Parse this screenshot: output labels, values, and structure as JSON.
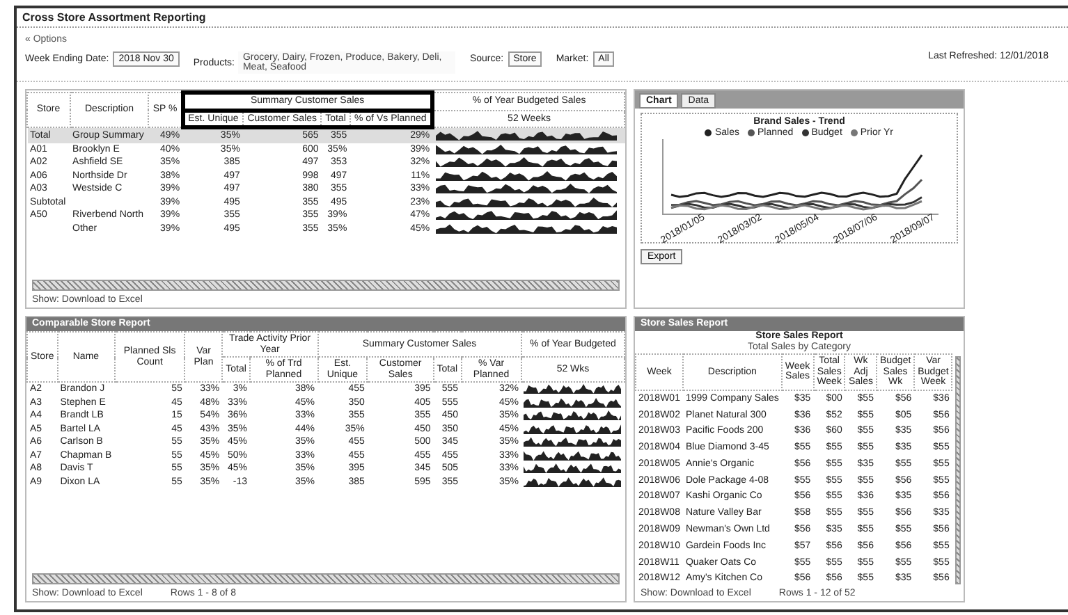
{
  "window": {
    "title": "Cross Store Assortment Reporting"
  },
  "options_link": "« Options",
  "filters": [
    {
      "label": "Week Ending Date:",
      "value": "2018 Nov 30"
    },
    {
      "label": "Products:",
      "value": "Grocery, Dairy, Frozen, Produce, Bakery, Deli, Meat, Seafood"
    },
    {
      "label": "Source:",
      "value": "Store"
    },
    {
      "label": "Market:",
      "value": "All"
    }
  ],
  "last_refreshed": "Last Refreshed: 12/01/2018",
  "summary_table": {
    "columns": [
      {
        "label": "Store"
      },
      {
        "label": "Description"
      },
      {
        "label": "SP %"
      },
      {
        "label": "Summary Customer Sales",
        "highlighted": true,
        "colspan": 4,
        "children": [
          "Est. Unique",
          "Customer Sales",
          "Total",
          "% of Vs Planned"
        ]
      },
      {
        "label": "% of Year Budgeted Sales",
        "children": [
          "52 Weeks"
        ]
      }
    ],
    "rows": [
      {
        "selected": true,
        "cells": [
          "Total",
          "Group Summary",
          "49%",
          "35%",
          "565",
          "355",
          "29%"
        ]
      },
      {
        "selected": false,
        "cells": [
          "A01",
          "Brooklyn E",
          "40%",
          "35%",
          "600",
          "35%",
          "39%"
        ]
      },
      {
        "selected": false,
        "cells": [
          "A02",
          "Ashfield SE",
          "35%",
          "385",
          "497",
          "353",
          "32%"
        ]
      },
      {
        "selected": false,
        "cells": [
          "A06",
          "Northside Dr",
          "38%",
          "497",
          "998",
          "497",
          "11%"
        ]
      },
      {
        "selected": false,
        "cells": [
          "A03",
          "Westside C",
          "39%",
          "497",
          "380",
          "355",
          "33%"
        ]
      },
      {
        "selected": false,
        "cells": [
          "Subtotal",
          "",
          "39%",
          "495",
          "355",
          "495",
          "23%"
        ]
      },
      {
        "selected": false,
        "cells": [
          "A50",
          "Riverbend North",
          "39%",
          "355",
          "355",
          "39%",
          "47%"
        ]
      },
      {
        "selected": false,
        "cells": [
          "",
          "Other",
          "39%",
          "495",
          "355",
          "35%",
          "45%"
        ]
      }
    ],
    "footer": "Show: Download to Excel"
  },
  "chart_panel": {
    "tabs": [
      {
        "label": "Chart",
        "selected": true
      },
      {
        "label": "Data",
        "selected": false
      }
    ],
    "title": "Brand Sales - Trend",
    "legend": [
      {
        "label": "Sales",
        "color": "#222222"
      },
      {
        "label": "Planned",
        "color": "#555555"
      },
      {
        "label": "Budget",
        "color": "#333333"
      },
      {
        "label": "Prior Yr",
        "color": "#777777"
      }
    ],
    "x_labels": [
      "2018/01/05",
      "2018/03/02",
      "2018/05/04",
      "2018/07/06",
      "2018/09/07"
    ],
    "export_button": "Export"
  },
  "store_table": {
    "title": "Comparable Store Report",
    "columns": [
      {
        "label": "Store"
      },
      {
        "label": "Name"
      },
      {
        "label": "Planned Sls Count"
      },
      {
        "label": "Var Plan"
      },
      {
        "label": "Trade Activity Prior Year",
        "colspan": 2,
        "children": [
          "Total",
          "% of Trd Planned"
        ]
      },
      {
        "label": "Summary Customer Sales",
        "colspan": 4,
        "children": [
          "Est. Unique",
          "Customer Sales",
          "Total",
          "% Var Planned"
        ]
      },
      {
        "label": "% of Year Budgeted",
        "children": [
          "52 Wks"
        ]
      }
    ],
    "rows": [
      [
        "A2",
        "Brandon J",
        "55",
        "33%",
        "3%",
        "38%",
        "455",
        "395",
        "555",
        "32%"
      ],
      [
        "A3",
        "Stephen E",
        "45",
        "48%",
        "33%",
        "45%",
        "350",
        "405",
        "555",
        "45%"
      ],
      [
        "A4",
        "Brandt LB",
        "15",
        "54%",
        "36%",
        "33%",
        "355",
        "355",
        "450",
        "35%"
      ],
      [
        "A5",
        "Bartel LA",
        "45",
        "43%",
        "35%",
        "44%",
        "35%",
        "450",
        "350",
        "45%"
      ],
      [
        "A6",
        "Carlson B",
        "55",
        "35%",
        "45%",
        "35%",
        "455",
        "500",
        "345",
        "35%"
      ],
      [
        "A7",
        "Chapman B",
        "55",
        "45%",
        "50%",
        "33%",
        "455",
        "455",
        "455",
        "33%"
      ],
      [
        "A8",
        "Davis T",
        "55",
        "35%",
        "45%",
        "35%",
        "395",
        "345",
        "505",
        "33%"
      ],
      [
        "A9",
        "Dixon LA",
        "55",
        "35%",
        "-13",
        "35%",
        "385",
        "595",
        "355",
        "35%"
      ]
    ],
    "footer": "Show: Download to Excel",
    "pager": "Rows 1 - 8 of 8"
  },
  "sales_table": {
    "title": "Store Sales Report",
    "subtitle": "Store Sales Report",
    "group_label": "Total Sales by Category",
    "columns": [
      "Week",
      "Description",
      "Week Sales",
      "Total Sales Week",
      "Wk Adj Sales",
      "Budget Sales Wk",
      "Var Budget Week"
    ],
    "rows": [
      [
        "2018W01",
        "1999 Company Sales",
        "$35",
        "$00",
        "$55",
        "$56",
        "$36"
      ],
      [
        "2018W02",
        "Planet Natural 300",
        "$36",
        "$52",
        "$55",
        "$05",
        "$56"
      ],
      [
        "2018W03",
        "Pacific Foods 200",
        "$36",
        "$60",
        "$55",
        "$35",
        "$56"
      ],
      [
        "2018W04",
        "Blue Diamond 3-45",
        "$55",
        "$55",
        "$55",
        "$35",
        "$55"
      ],
      [
        "2018W05",
        "Annie's Organic",
        "$56",
        "$55",
        "$35",
        "$55",
        "$55"
      ],
      [
        "2018W06",
        "Dole Package 4-08",
        "$55",
        "$55",
        "$55",
        "$56",
        "$55"
      ],
      [
        "2018W07",
        "Kashi Organic Co",
        "$56",
        "$55",
        "$36",
        "$35",
        "$56"
      ],
      [
        "2018W08",
        "Nature Valley Bar",
        "$58",
        "$55",
        "$55",
        "$56",
        "$35"
      ],
      [
        "2018W09",
        "Newman's Own Ltd",
        "$56",
        "$35",
        "$55",
        "$55",
        "$56"
      ],
      [
        "2018W10",
        "Gardein Foods Inc",
        "$57",
        "$56",
        "$56",
        "$56",
        "$55"
      ],
      [
        "2018W11",
        "Quaker Oats Co",
        "$55",
        "$55",
        "$55",
        "$55",
        "$55"
      ],
      [
        "2018W12",
        "Amy's Kitchen Co",
        "$56",
        "$56",
        "$55",
        "$35",
        "$56"
      ]
    ],
    "footer": "Show: Download to Excel",
    "pager": "Rows 1 - 12 of 52"
  }
}
